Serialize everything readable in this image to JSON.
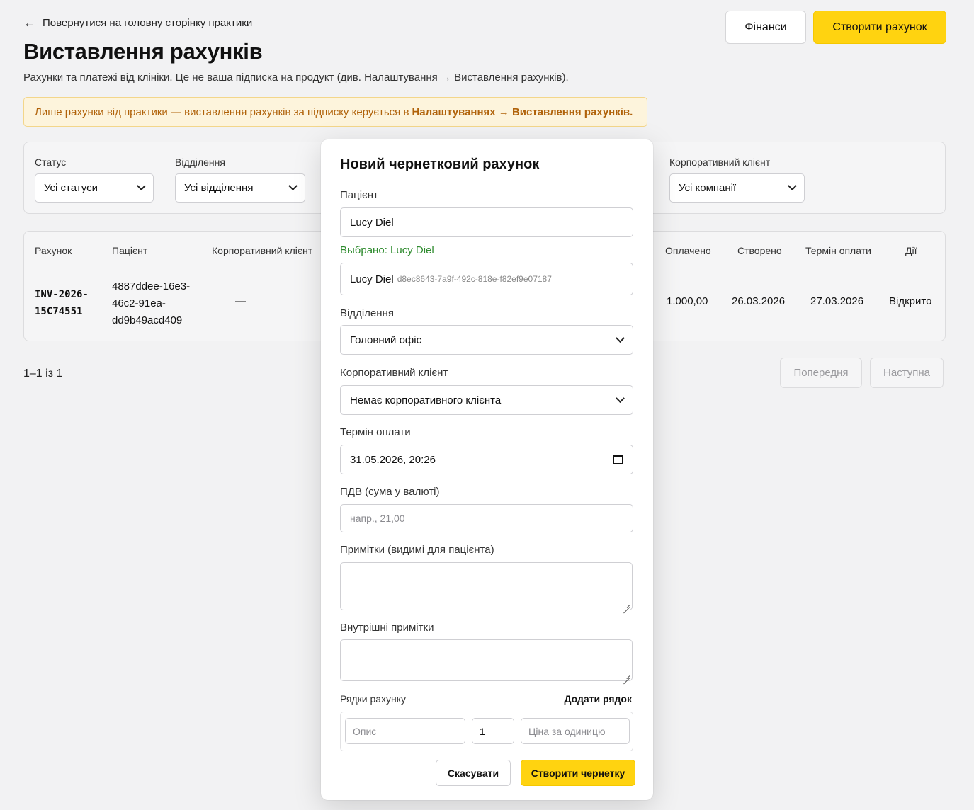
{
  "header": {
    "back_arrow": "←",
    "back_label": "Повернутися на головну сторінку практики",
    "title": "Виставлення рахунків",
    "subtitle": "Рахунки та платежі від клініки. Це не ваша підписка на продукт (див. Налаштування → Виставлення рахунків).",
    "finance_label": "Фінанси",
    "create_label": "Створити рахунок"
  },
  "alert": {
    "text": "Лише рахунки від практики — виставлення рахунків за підписку керується в ",
    "link": "Налаштуваннях → Виставлення рахунків."
  },
  "filters": {
    "status_label": "Статус",
    "status_value": "Усі статуси",
    "branch_label": "Відділення",
    "branch_value": "Усі відділення",
    "corporate_label": "Корпоративний клієнт",
    "corporate_value": "Усі компанії"
  },
  "table": {
    "headers": {
      "invoice": "Рахунок",
      "patient": "Пацієнт",
      "corporate": "Корпоративний клієнт",
      "paid": "Оплачено",
      "created": "Створено",
      "due": "Термін оплати",
      "actions": "Дії"
    },
    "rows": [
      {
        "invoice_line1": "INV-2026-",
        "invoice_line2": "15C74551",
        "patient_line1": "4887ddee-16e3-",
        "patient_line2": "46c2-91ea-",
        "patient_line3": "dd9b49acd409",
        "corporate": "—",
        "paid": "1.000,00",
        "created": "26.03.2026",
        "due": "27.03.2026",
        "action": "Відкрито"
      }
    ]
  },
  "pagination": {
    "summary": "1–1 із 1",
    "prev": "Попередня",
    "next": "Наступна"
  },
  "modal": {
    "title": "Новий чернетковий рахунок",
    "patient_label": "Пацієнт",
    "patient_value": "Lucy Diel",
    "selected_text": "Выбрано: Lucy Diel",
    "selected_name": "Lucy Diel",
    "selected_id": "d8ec8643-7a9f-492c-818e-f82ef9e07187",
    "branch_label": "Відділення",
    "branch_value": "Головний офіс",
    "corporate_label": "Корпоративний клієнт",
    "corporate_value": "Немає корпоративного клієнта",
    "due_label": "Термін оплати",
    "due_value": "31.05.2026, 20:26",
    "vat_label": "ПДВ (сума у валюті)",
    "vat_placeholder": "напр., 21,00",
    "notes_label": "Примітки (видимі для пацієнта)",
    "internal_label": "Внутрішні примітки",
    "lines_label": "Рядки рахунку",
    "add_line": "Додати рядок",
    "line_desc_placeholder": "Опис",
    "line_qty": "1",
    "line_price_placeholder": "Ціна за одиницю",
    "cancel": "Скасувати",
    "create_draft": "Створити чернетку"
  },
  "colors": {
    "accent": "#ffd310",
    "alert_bg": "#fdf4dc",
    "alert_text": "#b0620a",
    "selected_green": "#2e8b2e"
  }
}
